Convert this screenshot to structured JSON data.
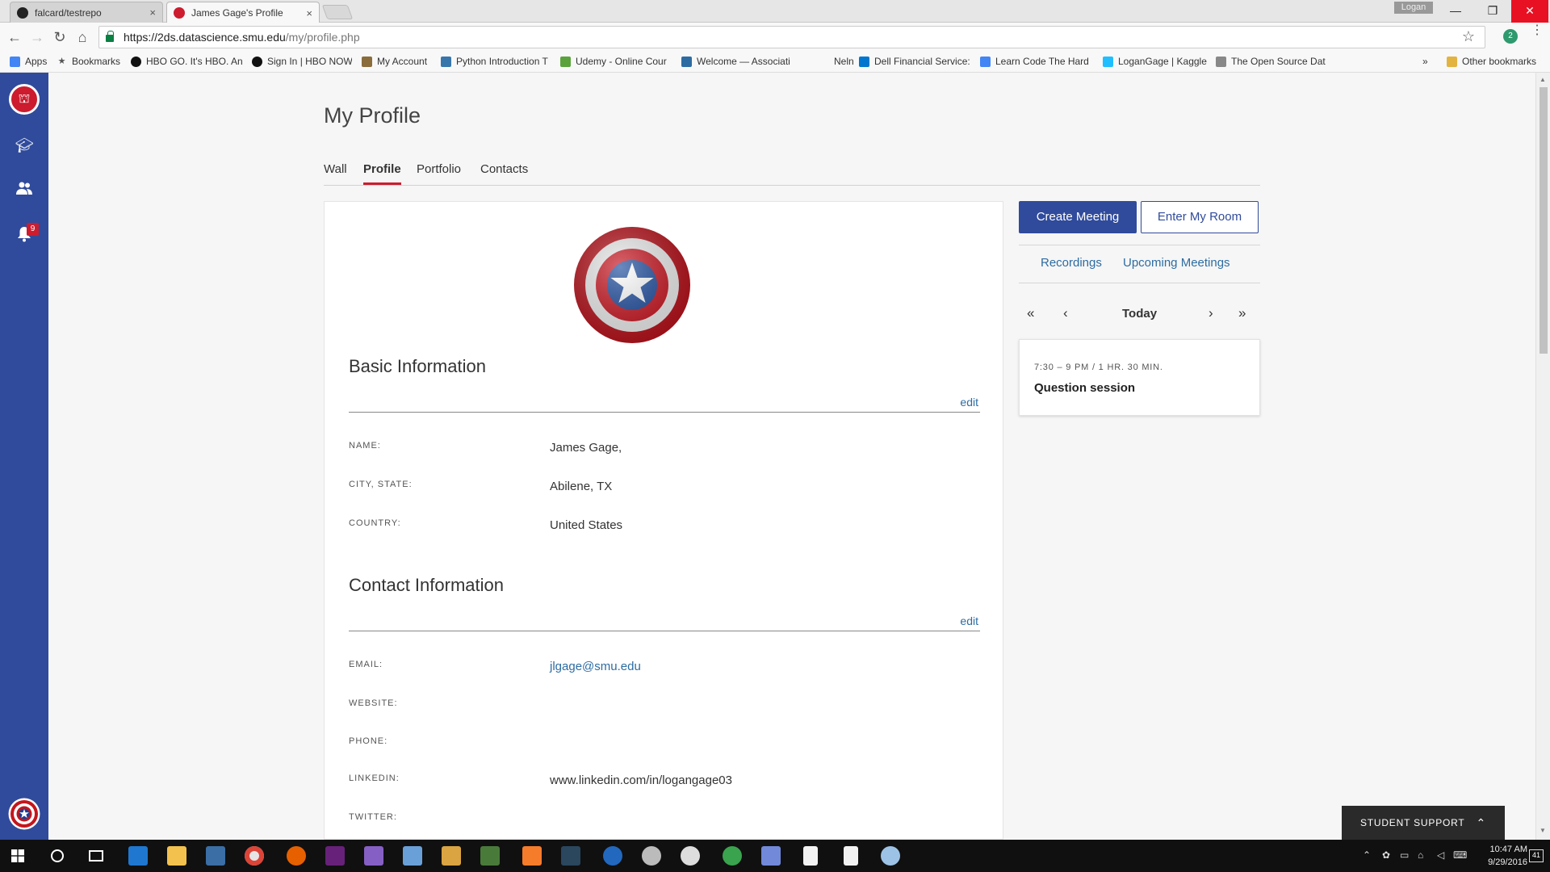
{
  "browser": {
    "tabs": [
      {
        "title": "falcard/testrepo",
        "close": "×"
      },
      {
        "title": "James Gage's Profile",
        "close": "×"
      }
    ],
    "user_chip": "Logan",
    "window_controls": {
      "minimize": "—",
      "restore": "❐",
      "close": "✕"
    },
    "url_host": "https://2ds.datascience.smu.edu",
    "url_path": "/my/profile.php",
    "extension_badge": "2",
    "bookmarks": [
      {
        "label": "Apps",
        "icon": "apps-grid-icon"
      },
      {
        "label": "Bookmarks",
        "icon": "star-icon"
      },
      {
        "label": "HBO GO. It's HBO. An",
        "icon": "hbo-icon"
      },
      {
        "label": "Sign In | HBO NOW",
        "icon": "hbo-icon"
      },
      {
        "label": "My Account",
        "icon": "account-icon"
      },
      {
        "label": "Python Introduction T",
        "icon": "python-icon"
      },
      {
        "label": "Udemy - Online Cour",
        "icon": "udemy-icon"
      },
      {
        "label": "Welcome — Associati",
        "icon": "diamond-icon"
      },
      {
        "label": "Nelnet",
        "icon": "nelnet-icon"
      },
      {
        "label": "Dell Financial Service:",
        "icon": "dell-icon"
      },
      {
        "label": "Learn Code The Hard",
        "icon": "google-icon"
      },
      {
        "label": "LoganGage | Kaggle",
        "icon": "kaggle-icon"
      },
      {
        "label": "The Open Source Dat",
        "icon": "page-icon"
      }
    ],
    "bookmarks_overflow": "»",
    "other_bookmarks": "Other bookmarks"
  },
  "sidebar": {
    "notification_count": "9"
  },
  "page": {
    "title": "My Profile",
    "tabs": [
      {
        "label": "Wall",
        "active": false
      },
      {
        "label": "Profile",
        "active": true
      },
      {
        "label": "Portfolio",
        "active": false
      },
      {
        "label": "Contacts",
        "active": false
      }
    ]
  },
  "basic_info": {
    "title": "Basic Information",
    "edit": "edit",
    "fields": [
      {
        "label": "NAME:",
        "value": "James Gage,"
      },
      {
        "label": "CITY, STATE:",
        "value": "Abilene, TX"
      },
      {
        "label": "COUNTRY:",
        "value": "United States"
      }
    ]
  },
  "contact_info": {
    "title": "Contact Information",
    "edit": "edit",
    "fields": [
      {
        "label": "EMAIL:",
        "value": "jlgage@smu.edu"
      },
      {
        "label": "WEBSITE:",
        "value": ""
      },
      {
        "label": "PHONE:",
        "value": ""
      },
      {
        "label": "LINKEDIN:",
        "value": "www.linkedin.com/in/logangage03"
      },
      {
        "label": "TWITTER:",
        "value": ""
      }
    ]
  },
  "meetings": {
    "create_label": "Create Meeting",
    "enter_room_label": "Enter My Room",
    "recordings_label": "Recordings",
    "upcoming_label": "Upcoming Meetings",
    "nav": {
      "first": "«",
      "prev": "‹",
      "today": "Today",
      "next": "›",
      "last": "»"
    },
    "events": [
      {
        "time": "7:30 – 9 PM / 1 HR. 30 MIN.",
        "title": "Question session"
      }
    ]
  },
  "support": {
    "label": "STUDENT SUPPORT",
    "chevron": "⌃"
  },
  "taskbar": {
    "time": "10:47 AM",
    "date": "9/29/2016",
    "notifications": "41"
  },
  "colors": {
    "brand_blue": "#304b9b",
    "brand_red": "#cc1c2e",
    "link_blue": "#2d6ca2"
  }
}
